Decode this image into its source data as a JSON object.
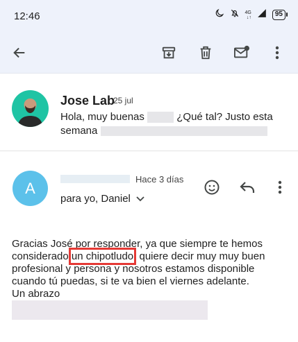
{
  "status_bar": {
    "time": "12:46",
    "network": "4G",
    "battery": "95",
    "icons": [
      "moon-icon",
      "bell-off-icon",
      "signal-icon",
      "battery-icon"
    ]
  },
  "toolbar": {
    "back_icon": "arrow-back-icon",
    "archive_icon": "archive-icon",
    "delete_icon": "trash-icon",
    "mark_unread_icon": "mail-unread-icon",
    "more_icon": "more-vert-icon"
  },
  "message1": {
    "sender": "Jose Lab",
    "date": "25 jul",
    "snippet_part1": "Hola, muy buenas",
    "snippet_part2": "¿Qué tal? Justo esta",
    "snippet_part3": "semana"
  },
  "message2": {
    "avatar_letter": "A",
    "date": "Hace 3 días",
    "to_line": "para yo, Daniel",
    "emoji_icon": "smile-icon",
    "reply_icon": "reply-icon",
    "more_icon": "more-vert-icon",
    "body_part1": "Gracias José por responder, ya que siempre te hemos considerado ",
    "body_highlight": "un chipotludo",
    "body_part2": ", quiere decir muy muy buen profesional y persona y nosotros estamos disponible cuando tú puedas, si te va bien el viernes adelante.",
    "closing": "Un abrazo"
  },
  "colors": {
    "header_bg": "#eef2fb",
    "avatar_a": "#5cc1ea",
    "avatar_photo_bg": "#1fc4a4",
    "highlight_box": "#e53935"
  }
}
